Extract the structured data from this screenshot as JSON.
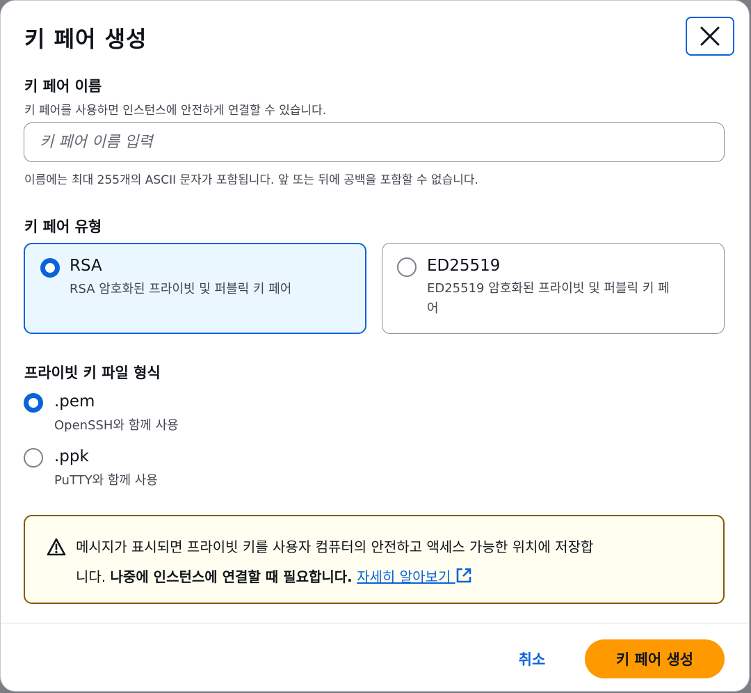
{
  "dialog": {
    "title": "키 페어 생성",
    "close_icon": "close-icon"
  },
  "key_pair_name": {
    "label": "키 페어 이름",
    "description": "키 페어를 사용하면 인스턴스에 안전하게 연결할 수 있습니다.",
    "value": "",
    "placeholder": "키 페어 이름 입력",
    "constraint": "이름에는 최대 255개의 ASCII 문자가 포함됩니다. 앞 또는 뒤에 공백을 포함할 수 없습니다."
  },
  "key_pair_type": {
    "label": "키 페어 유형",
    "options": [
      {
        "title": "RSA",
        "description": "RSA 암호화된 프라이빗 및 퍼블릭 키 페어",
        "selected": true
      },
      {
        "title": "ED25519",
        "description_line1": "ED25519 암호화된 프라이빗 및 퍼블릭 키 페",
        "description_line2": "어",
        "selected": false
      }
    ]
  },
  "private_key_format": {
    "label": "프라이빗 키 파일 형식",
    "options": [
      {
        "title": ".pem",
        "description": "OpenSSH와 함께 사용",
        "selected": true
      },
      {
        "title": ".ppk",
        "description": "PuTTY와 함께 사용",
        "selected": false
      }
    ]
  },
  "alert": {
    "icon": "warning-icon",
    "text_line1": "메시지가 표시되면 프라이빗 키를 사용자 컴퓨터의 안전하고 액세스 가능한 위치에 저장합",
    "text_line2_prefix": "니다. ",
    "text_bold": "나중에 인스턴스에 연결할 때 필요합니다.",
    "link_text": "자세히 알아보기",
    "link_icon": "external-link-icon"
  },
  "footer": {
    "cancel_label": "취소",
    "create_label": "키 페어 생성"
  },
  "colors": {
    "accent": "#0a63d8",
    "primary_button": "#ff9900",
    "warning_border": "#855900",
    "warning_background": "#fffef0",
    "selected_tile_background": "#ebf7fe"
  }
}
